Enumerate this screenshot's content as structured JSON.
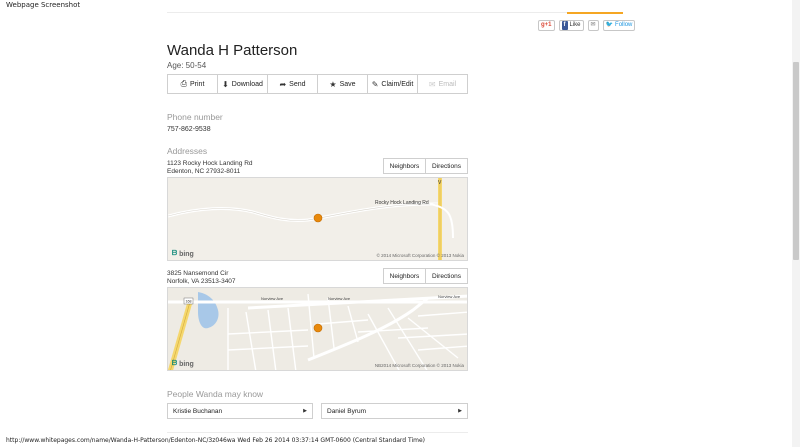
{
  "header_label": "Webpage Screenshot",
  "social": {
    "gplus": "g+1",
    "fb_like": "Like",
    "twitter": "Follow"
  },
  "person": {
    "name": "Wanda H Patterson",
    "age": "Age: 50-54"
  },
  "actions": [
    {
      "label": "Print",
      "icon": "print-icon"
    },
    {
      "label": "Download",
      "icon": "download-icon"
    },
    {
      "label": "Send",
      "icon": "send-icon"
    },
    {
      "label": "Save",
      "icon": "star-icon"
    },
    {
      "label": "Claim/Edit",
      "icon": "pencil-icon"
    },
    {
      "label": "Email",
      "icon": "email-icon"
    }
  ],
  "phone": {
    "title": "Phone number",
    "number": "757-862-9538"
  },
  "addresses": {
    "title": "Addresses",
    "items": [
      {
        "line1": "1123 Rocky Hock Landing Rd",
        "line2": "Edenton, NC 27932-8011",
        "neighbors": "Neighbors",
        "directions": "Directions",
        "map_road": "Rocky Hock Landing Rd",
        "map_copyright": "© 2014 Microsoft Corporation © 2013 Nokia"
      },
      {
        "line1": "3825 Nansemond Cir",
        "line2": "Norfolk, VA 23513-3407",
        "neighbors": "Neighbors",
        "directions": "Directions",
        "map_road": "Norview Ave",
        "map_copyright": "NB2014 Microsoft Corporation © 2013 Nokia"
      }
    ]
  },
  "bing_label": "bing",
  "people": {
    "title": "People Wanda may know",
    "items": [
      "Kristie Buchanan",
      "Daniel Byrum"
    ]
  },
  "footer": "http://www.whitepages.com/name/Wanda-H-Patterson/Edenton-NC/3z046wa Wed Feb 26 2014 03:37:14 GMT-0600 (Central Standard Time)",
  "colors": {
    "accent": "#f5a623",
    "marker": "#e8890c"
  }
}
